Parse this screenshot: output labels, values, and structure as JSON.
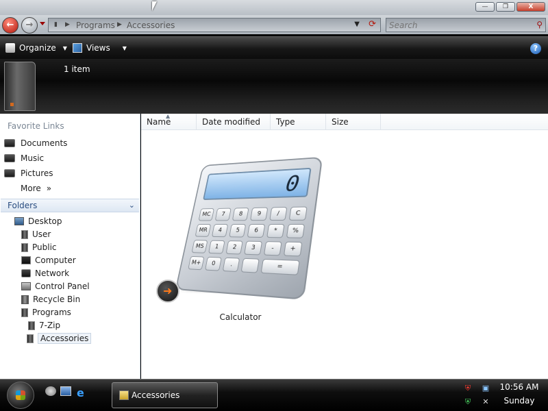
{
  "titlebar": {
    "buttons": [
      {
        "name": "minimize-button",
        "label": "—"
      },
      {
        "name": "maximize-button",
        "label": "❐"
      },
      {
        "name": "close-button",
        "label": "X"
      }
    ]
  },
  "address_bar": {
    "back_label": "←",
    "forward_label": "→",
    "breadcrumbs": [
      "Programs",
      "Accessories"
    ],
    "separator": "▶",
    "dropdown_glyph": "▼",
    "refresh_glyph": "⟳",
    "search_placeholder": "Search",
    "search_glyph": "⚲"
  },
  "command_bar": {
    "organize_label": "Organize",
    "views_label": "Views",
    "caret": "▼",
    "help_label": "?"
  },
  "details": {
    "item_count": "1 item"
  },
  "nav_pane": {
    "favorites_title": "Favorite Links",
    "favorites": [
      {
        "label": "Documents"
      },
      {
        "label": "Music"
      },
      {
        "label": "Pictures"
      },
      {
        "label": "More"
      }
    ],
    "more_glyph": "»",
    "folders_title": "Folders",
    "folders_chevron": "⌄",
    "tree": [
      {
        "label": "Desktop"
      },
      {
        "label": "User"
      },
      {
        "label": "Public"
      },
      {
        "label": "Computer"
      },
      {
        "label": "Network"
      },
      {
        "label": "Control Panel"
      },
      {
        "label": "Recycle Bin"
      },
      {
        "label": "Programs"
      },
      {
        "label": "7-Zip"
      },
      {
        "label": "Accessories"
      }
    ]
  },
  "content": {
    "columns": [
      "Name",
      "Date modified",
      "Type",
      "Size"
    ],
    "sort_mark": "▲",
    "files": [
      {
        "name": "Calculator",
        "display": "0"
      }
    ],
    "calc_keys": [
      "MC",
      "7",
      "8",
      "9",
      "/",
      "C",
      "MR",
      "4",
      "5",
      "6",
      "*",
      "%",
      "MS",
      "1",
      "2",
      "3",
      "-",
      "+",
      "M+",
      "0",
      ".",
      "",
      "="
    ]
  },
  "taskbar": {
    "task_label": "Accessories",
    "ie_glyph": "e",
    "tray_glyphs": [
      "⛨",
      "▣",
      "⛨",
      "✕"
    ],
    "time": "10:56 AM",
    "day": "Sunday"
  }
}
